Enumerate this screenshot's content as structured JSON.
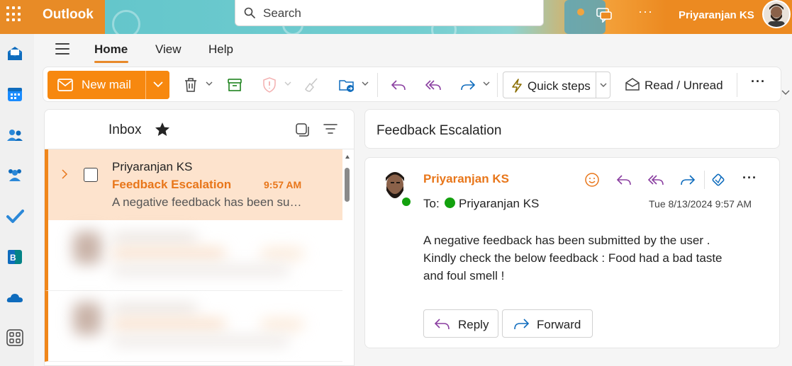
{
  "app": {
    "title": "Outlook",
    "user_name": "Priyaranjan KS"
  },
  "search": {
    "placeholder": "Search"
  },
  "ribbon": {
    "tabs": [
      "Home",
      "View",
      "Help"
    ],
    "active_tab": "Home"
  },
  "toolbar": {
    "new_mail_label": "New mail",
    "quick_steps_label": "Quick steps",
    "read_unread_label": "Read / Unread",
    "more_label": "···"
  },
  "topbar": {
    "more_label": "···"
  },
  "mail_list": {
    "folder_title": "Inbox",
    "items": [
      {
        "sender": "Priyaranjan KS",
        "subject": "Feedback Escalation",
        "time": "9:57 AM",
        "preview": "A negative feedback has been submitted by the user"
      }
    ]
  },
  "reading_pane": {
    "subject": "Feedback Escalation",
    "sender": "Priyaranjan KS",
    "to_label": "To:",
    "to_name": "Priyaranjan KS",
    "date": "Tue 8/13/2024 9:57 AM",
    "body": "A negative feedback has been submitted by the user .\nKindly check the below feedback : Food had a bad taste\nand foul smell !",
    "more_label": "···",
    "reply_label": "Reply",
    "forward_label": "Forward"
  },
  "colors": {
    "brand_orange": "#ec8a21",
    "new_mail_orange": "#f7880f",
    "selected_row": "#fde3cd",
    "accent_text": "#e8761a",
    "presence_green": "#13a10e"
  },
  "icons": {
    "rail": [
      "mail-icon",
      "calendar-icon",
      "people-icon",
      "groups-icon",
      "todo-icon",
      "bookings-icon",
      "onedrive-icon",
      "apps-icon"
    ],
    "toolbar": [
      "delete-icon",
      "archive-icon",
      "report-icon",
      "sweep-icon",
      "move-to-icon",
      "reply-icon",
      "reply-all-icon",
      "forward-icon",
      "quick-steps-icon",
      "read-unread-icon"
    ]
  }
}
